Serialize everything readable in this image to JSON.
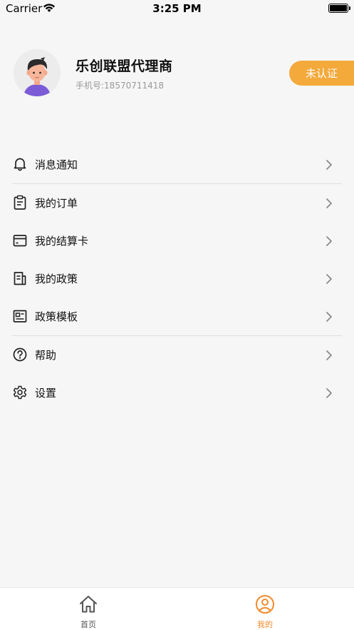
{
  "status_bar": {
    "carrier": "Carrier",
    "time": "3:25 PM"
  },
  "profile": {
    "name": "乐创联盟代理商",
    "phone": "手机号:18570711418",
    "verify_label": "未认证",
    "accent_color": "#f4a93b"
  },
  "menu": {
    "items": [
      {
        "label": "消息通知",
        "icon": "bell-icon"
      },
      {
        "label": "我的订单",
        "icon": "clipboard-icon"
      },
      {
        "label": "我的结算卡",
        "icon": "card-icon"
      },
      {
        "label": "我的政策",
        "icon": "document-icon"
      },
      {
        "label": "政策模板",
        "icon": "template-icon"
      },
      {
        "label": "帮助",
        "icon": "help-icon"
      },
      {
        "label": "设置",
        "icon": "gear-icon"
      }
    ]
  },
  "tabbar": {
    "tabs": [
      {
        "label": "首页",
        "icon": "home-icon",
        "active": false
      },
      {
        "label": "我的",
        "icon": "user-icon",
        "active": true
      }
    ],
    "active_color": "#f08a2c",
    "inactive_color": "#555555"
  }
}
